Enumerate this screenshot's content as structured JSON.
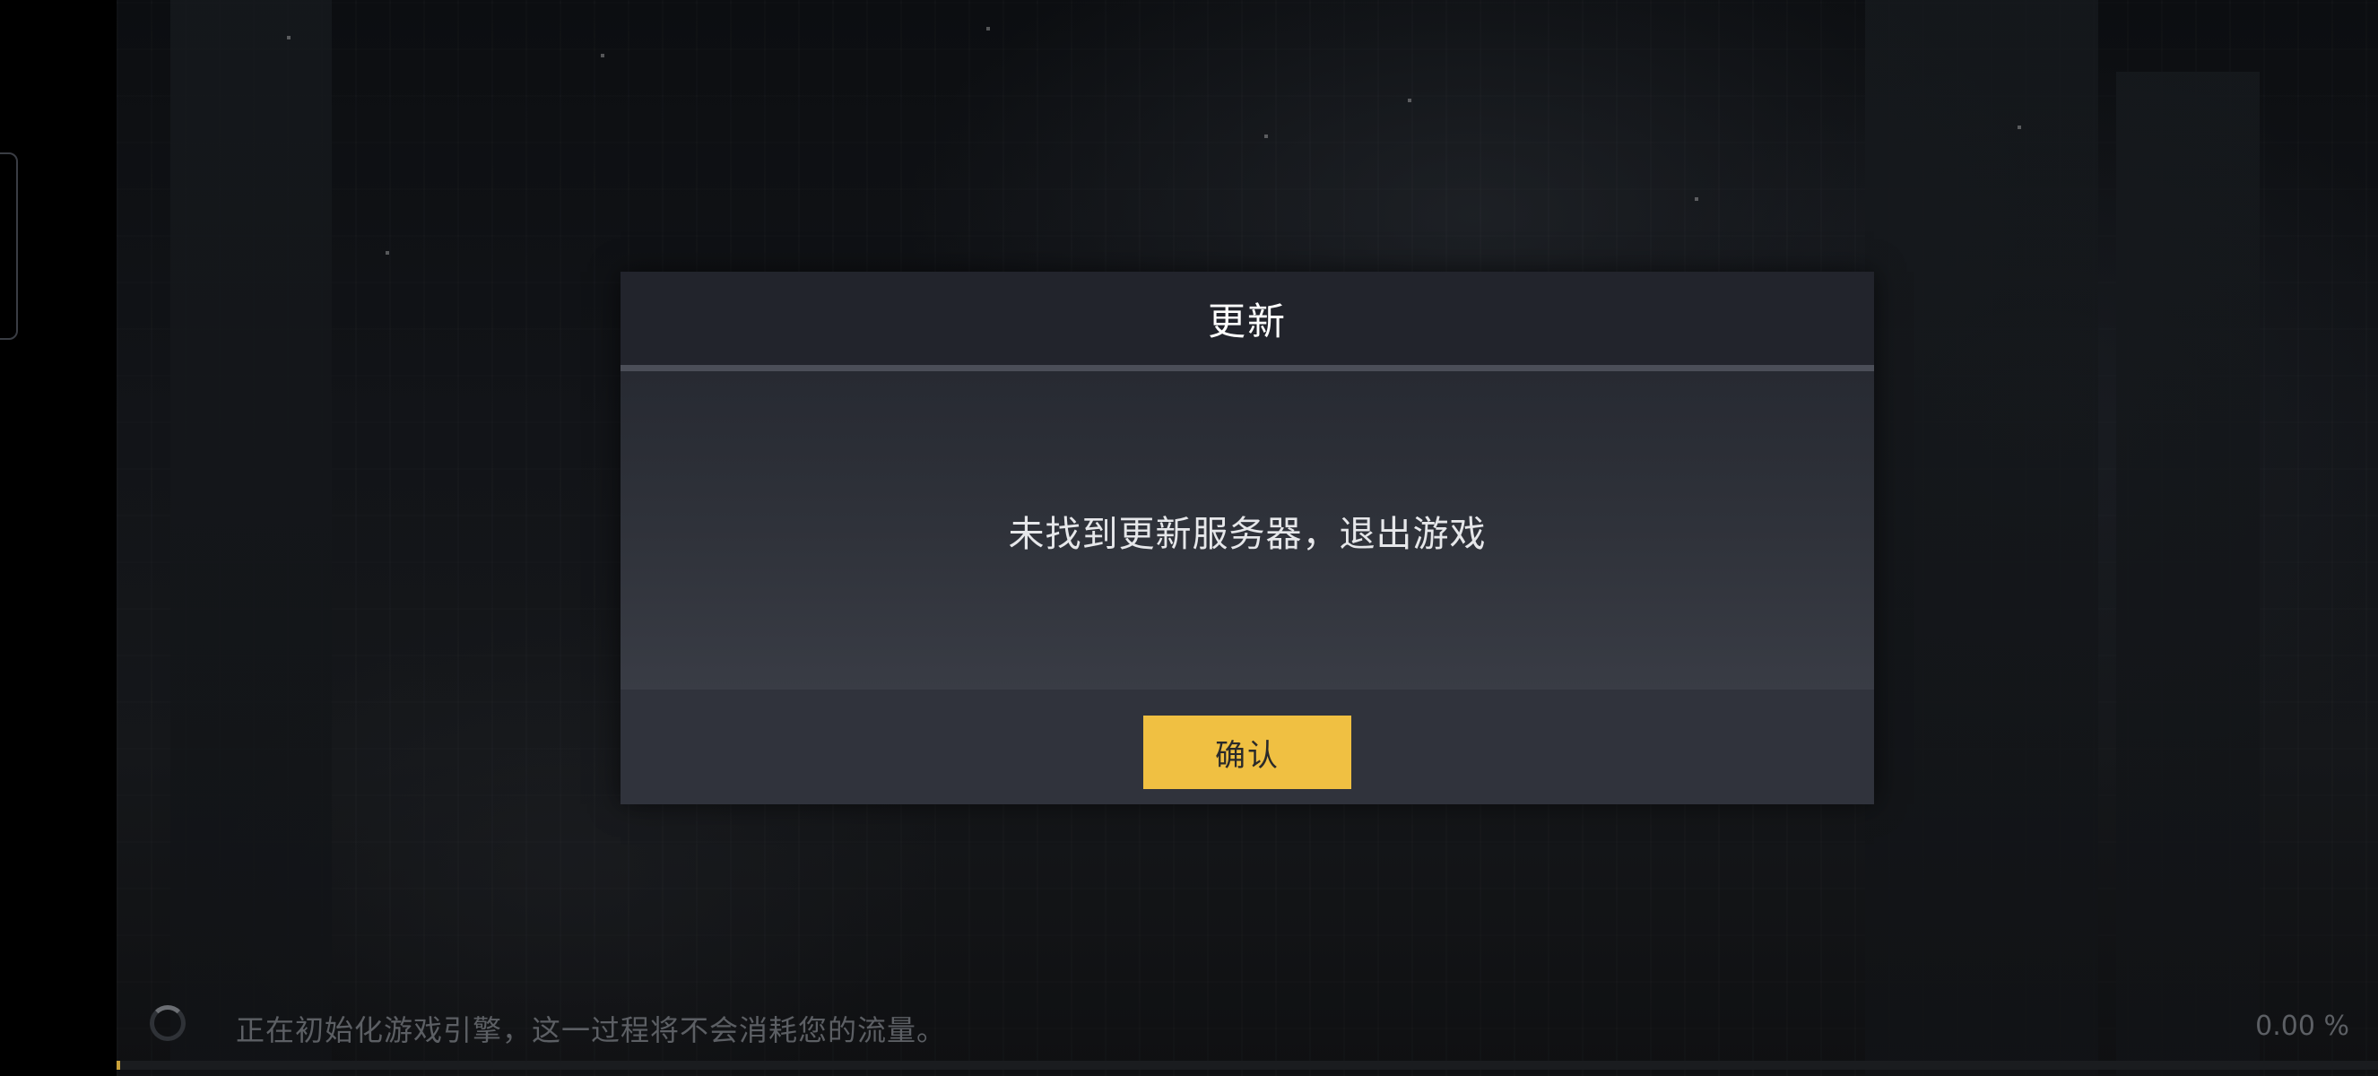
{
  "dialog": {
    "title": "更新",
    "message": "未找到更新服务器，退出游戏",
    "confirm_label": "确认"
  },
  "status": {
    "loading_text": "正在初始化游戏引擎，这一过程将不会消耗您的流量。",
    "progress_text": "0.00 %",
    "progress_fraction": 0.0
  },
  "colors": {
    "accent": "#f0c042",
    "dialog_header": "#22242c",
    "dialog_body": "#30333c"
  },
  "icons": {
    "spinner": "loading-spinner-icon"
  }
}
